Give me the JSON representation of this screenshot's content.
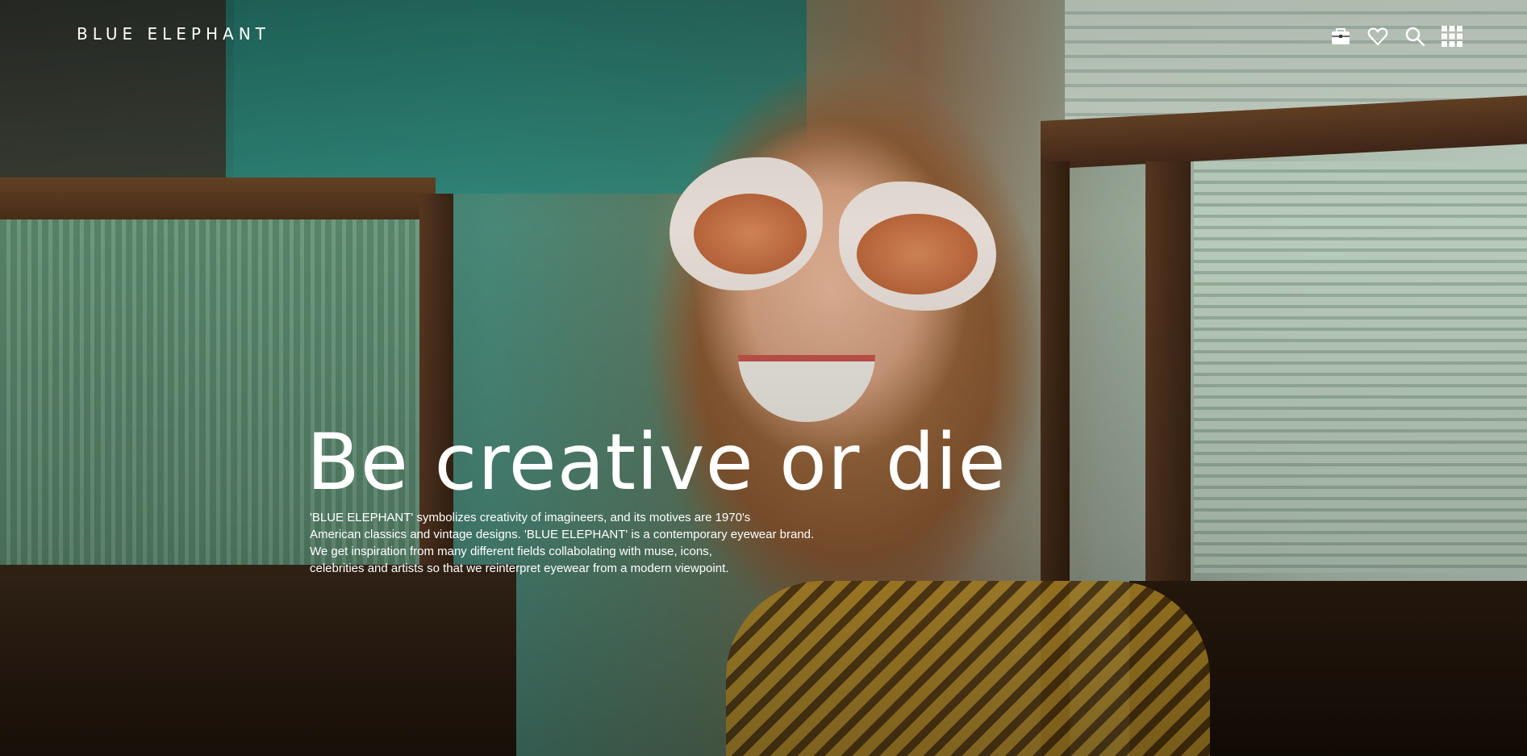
{
  "brand": {
    "logo_text": "BLUE ELEPHANT"
  },
  "header": {
    "icons": [
      {
        "name": "shopping-bag-icon"
      },
      {
        "name": "heart-icon"
      },
      {
        "name": "search-icon"
      },
      {
        "name": "grid-menu-icon"
      }
    ]
  },
  "hero": {
    "headline": "Be creative or die",
    "description_lines": [
      "'BLUE ELEPHANT' symbolizes creativity of imagineers, and its motives are 1970's",
      "American classics and vintage designs. 'BLUE ELEPHANT' is a contemporary eyewear brand.",
      "We get inspiration from many different fields collabolating with muse, icons,",
      "celebrities and artists so that we reinterpret eyewear from a modern viewpoint."
    ]
  },
  "colors": {
    "text": "#ffffff",
    "teal_wall": "#2d8a7d",
    "wood": "#5a3a22"
  }
}
